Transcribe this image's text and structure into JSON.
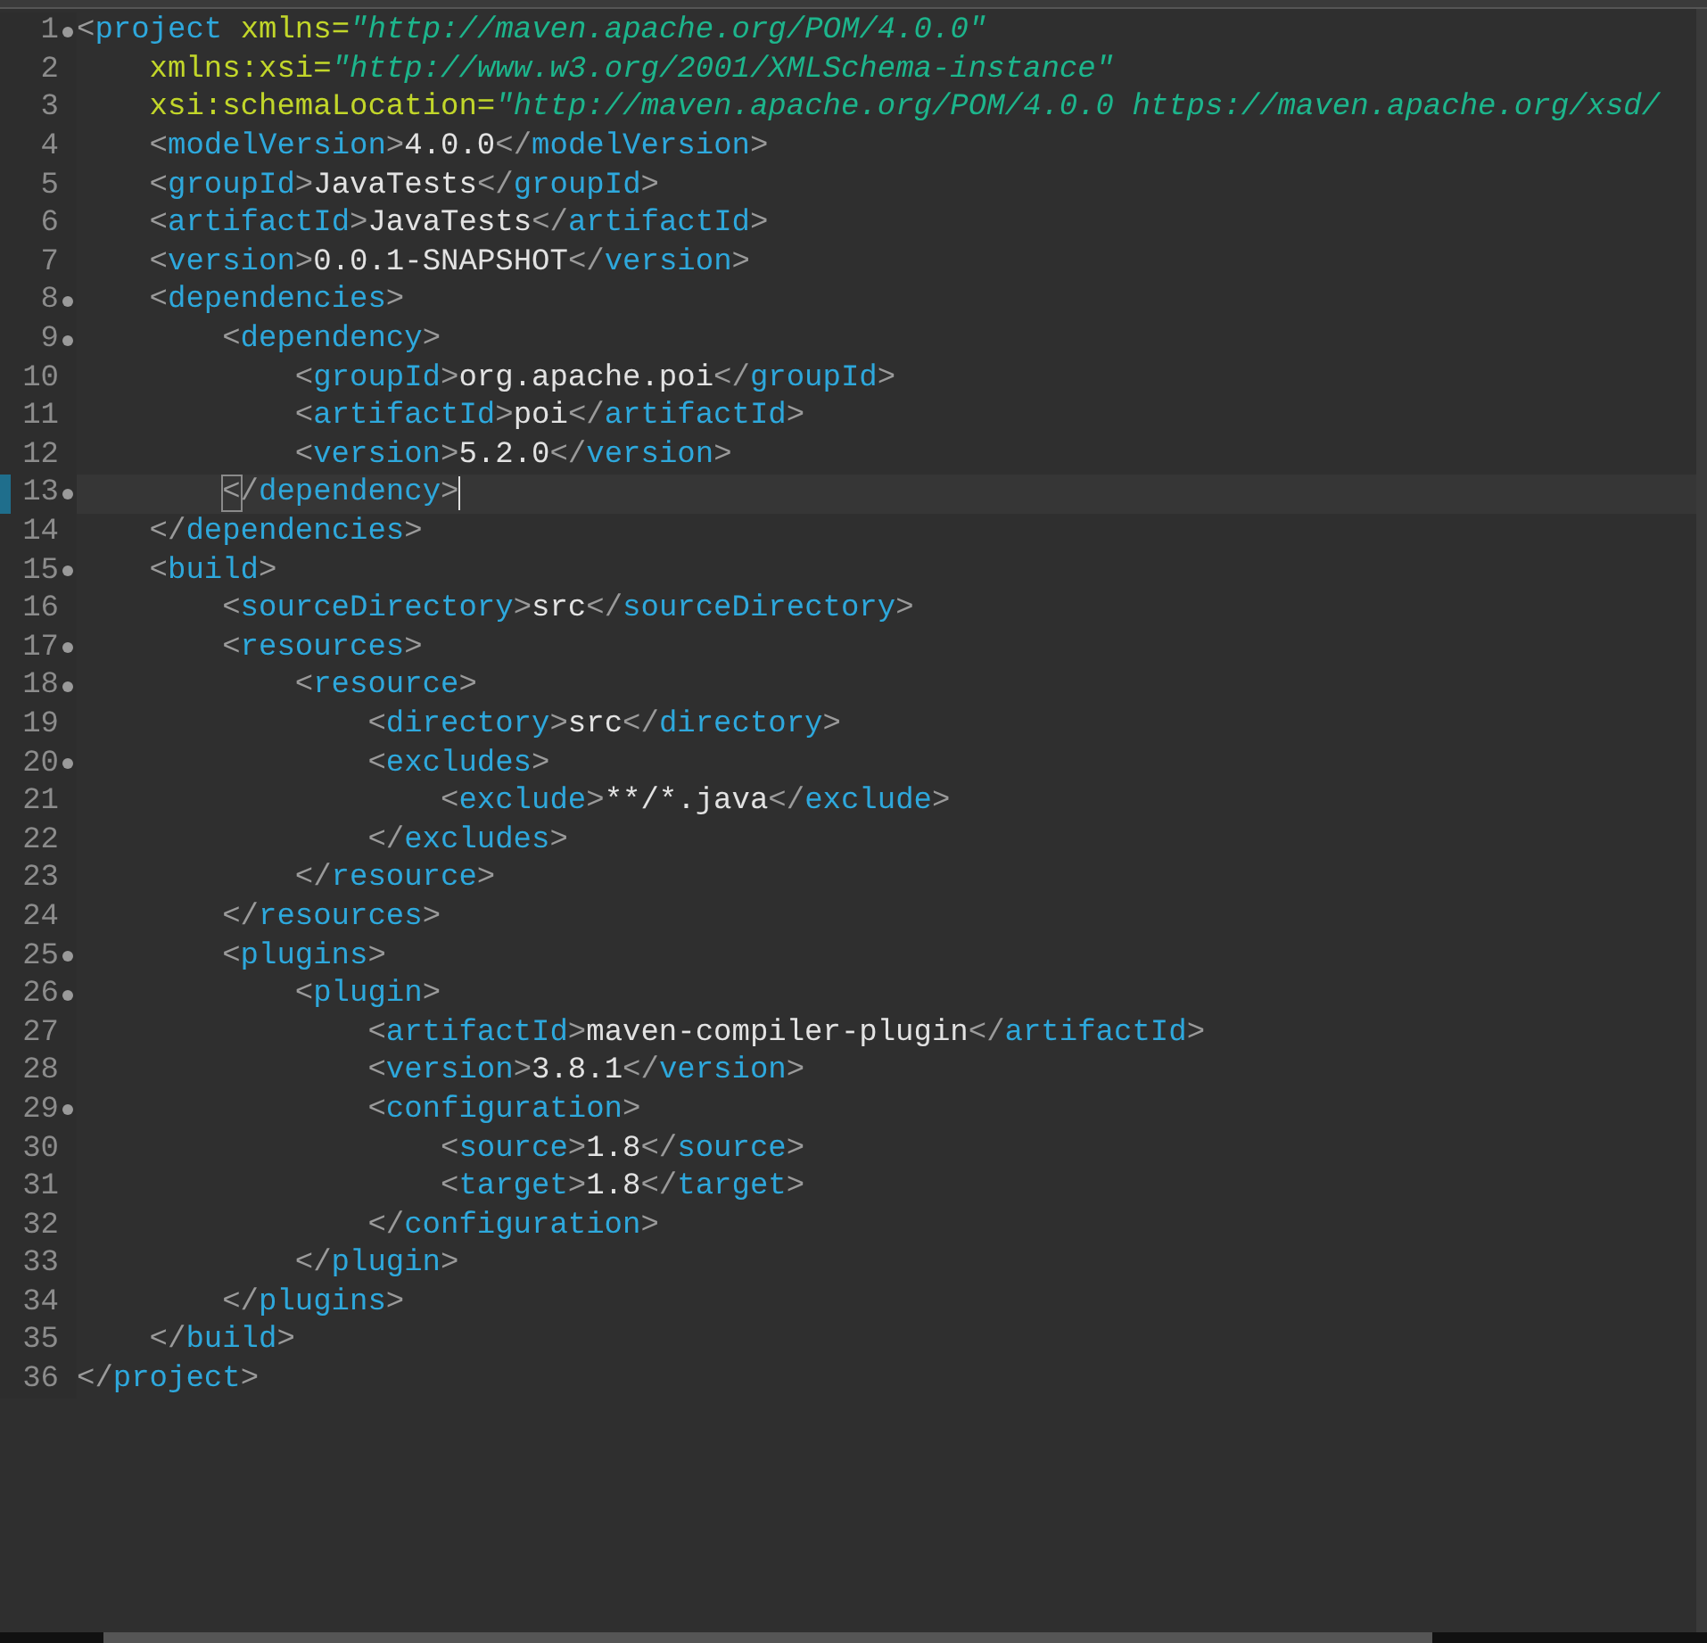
{
  "editor": {
    "lines": [
      {
        "number": "1",
        "foldable": true,
        "changed": false,
        "current": false,
        "tokens": [
          {
            "kind": "bracket",
            "text": "<"
          },
          {
            "kind": "tag",
            "text": "project "
          },
          {
            "kind": "attr",
            "text": "xmlns="
          },
          {
            "kind": "string",
            "text": "\"http://maven.apache.org/POM/4.0.0\""
          }
        ],
        "children": [
          {
            "number": "2",
            "foldable": false,
            "changed": false,
            "current": false,
            "tokens": [
              {
                "kind": "attr",
                "text": "xmlns:xsi="
              },
              {
                "kind": "string",
                "text": "\"http://www.w3.org/2001/XMLSchema-instance\""
              }
            ]
          },
          {
            "number": "3",
            "foldable": false,
            "changed": false,
            "current": false,
            "tokens": [
              {
                "kind": "attr",
                "text": "xsi:schemaLocation="
              },
              {
                "kind": "string",
                "text": "\"http://maven.apache.org/POM/4.0.0 https://maven.apache.org/xsd/"
              }
            ]
          },
          {
            "number": "4",
            "foldable": false,
            "changed": false,
            "current": false,
            "tokens": [
              {
                "kind": "bracket",
                "text": "<"
              },
              {
                "kind": "tag",
                "text": "modelVersion"
              },
              {
                "kind": "bracket",
                "text": ">"
              },
              {
                "kind": "text",
                "text": "4.0.0"
              },
              {
                "kind": "bracket",
                "text": "</"
              },
              {
                "kind": "tag",
                "text": "modelVersion"
              },
              {
                "kind": "bracket",
                "text": ">"
              }
            ]
          },
          {
            "number": "5",
            "foldable": false,
            "changed": false,
            "current": false,
            "tokens": [
              {
                "kind": "bracket",
                "text": "<"
              },
              {
                "kind": "tag",
                "text": "groupId"
              },
              {
                "kind": "bracket",
                "text": ">"
              },
              {
                "kind": "text",
                "text": "JavaTests"
              },
              {
                "kind": "bracket",
                "text": "</"
              },
              {
                "kind": "tag",
                "text": "groupId"
              },
              {
                "kind": "bracket",
                "text": ">"
              }
            ]
          },
          {
            "number": "6",
            "foldable": false,
            "changed": false,
            "current": false,
            "tokens": [
              {
                "kind": "bracket",
                "text": "<"
              },
              {
                "kind": "tag",
                "text": "artifactId"
              },
              {
                "kind": "bracket",
                "text": ">"
              },
              {
                "kind": "text",
                "text": "JavaTests"
              },
              {
                "kind": "bracket",
                "text": "</"
              },
              {
                "kind": "tag",
                "text": "artifactId"
              },
              {
                "kind": "bracket",
                "text": ">"
              }
            ]
          },
          {
            "number": "7",
            "foldable": false,
            "changed": false,
            "current": false,
            "tokens": [
              {
                "kind": "bracket",
                "text": "<"
              },
              {
                "kind": "tag",
                "text": "version"
              },
              {
                "kind": "bracket",
                "text": ">"
              },
              {
                "kind": "text",
                "text": "0.0.1-SNAPSHOT"
              },
              {
                "kind": "bracket",
                "text": "</"
              },
              {
                "kind": "tag",
                "text": "version"
              },
              {
                "kind": "bracket",
                "text": ">"
              }
            ]
          },
          {
            "number": "8",
            "foldable": true,
            "changed": false,
            "current": false,
            "tokens": [
              {
                "kind": "bracket",
                "text": "<"
              },
              {
                "kind": "tag",
                "text": "dependencies"
              },
              {
                "kind": "bracket",
                "text": ">"
              }
            ],
            "children": [
              {
                "number": "9",
                "foldable": true,
                "changed": false,
                "current": false,
                "tokens": [
                  {
                    "kind": "bracket",
                    "text": "<"
                  },
                  {
                    "kind": "tag",
                    "text": "dependency"
                  },
                  {
                    "kind": "bracket",
                    "text": ">"
                  }
                ],
                "children": [
                  {
                    "number": "10",
                    "foldable": false,
                    "changed": false,
                    "current": false,
                    "tokens": [
                      {
                        "kind": "bracket",
                        "text": "<"
                      },
                      {
                        "kind": "tag",
                        "text": "groupId"
                      },
                      {
                        "kind": "bracket",
                        "text": ">"
                      },
                      {
                        "kind": "text",
                        "text": "org.apache.poi"
                      },
                      {
                        "kind": "bracket",
                        "text": "</"
                      },
                      {
                        "kind": "tag",
                        "text": "groupId"
                      },
                      {
                        "kind": "bracket",
                        "text": ">"
                      }
                    ]
                  },
                  {
                    "number": "11",
                    "foldable": false,
                    "changed": false,
                    "current": false,
                    "tokens": [
                      {
                        "kind": "bracket",
                        "text": "<"
                      },
                      {
                        "kind": "tag",
                        "text": "artifactId"
                      },
                      {
                        "kind": "bracket",
                        "text": ">"
                      },
                      {
                        "kind": "text",
                        "text": "poi"
                      },
                      {
                        "kind": "bracket",
                        "text": "</"
                      },
                      {
                        "kind": "tag",
                        "text": "artifactId"
                      },
                      {
                        "kind": "bracket",
                        "text": ">"
                      }
                    ]
                  },
                  {
                    "number": "12",
                    "foldable": false,
                    "changed": false,
                    "current": false,
                    "tokens": [
                      {
                        "kind": "bracket",
                        "text": "<"
                      },
                      {
                        "kind": "tag",
                        "text": "version"
                      },
                      {
                        "kind": "bracket",
                        "text": ">"
                      },
                      {
                        "kind": "text",
                        "text": "5.2.0"
                      },
                      {
                        "kind": "bracket",
                        "text": "</"
                      },
                      {
                        "kind": "tag",
                        "text": "version"
                      },
                      {
                        "kind": "bracket",
                        "text": ">"
                      }
                    ]
                  }
                ]
              },
              {
                "number": "13",
                "foldable": true,
                "changed": true,
                "current": true,
                "tokens": [
                  {
                    "kind": "matched-bracket",
                    "text": "<"
                  },
                  {
                    "kind": "bracket",
                    "text": "/"
                  },
                  {
                    "kind": "tag",
                    "text": "dependency"
                  },
                  {
                    "kind": "bracket",
                    "text": ">"
                  }
                ]
              }
            ]
          },
          {
            "number": "14",
            "foldable": false,
            "changed": false,
            "current": false,
            "tokens": [
              {
                "kind": "bracket",
                "text": "</"
              },
              {
                "kind": "tag",
                "text": "dependencies"
              },
              {
                "kind": "bracket",
                "text": ">"
              }
            ]
          },
          {
            "number": "15",
            "foldable": true,
            "changed": false,
            "current": false,
            "tokens": [
              {
                "kind": "bracket",
                "text": "<"
              },
              {
                "kind": "tag",
                "text": "build"
              },
              {
                "kind": "bracket",
                "text": ">"
              }
            ],
            "children": [
              {
                "number": "16",
                "foldable": false,
                "changed": false,
                "current": false,
                "tokens": [
                  {
                    "kind": "bracket",
                    "text": "<"
                  },
                  {
                    "kind": "tag",
                    "text": "sourceDirectory"
                  },
                  {
                    "kind": "bracket",
                    "text": ">"
                  },
                  {
                    "kind": "text",
                    "text": "src"
                  },
                  {
                    "kind": "bracket",
                    "text": "</"
                  },
                  {
                    "kind": "tag",
                    "text": "sourceDirectory"
                  },
                  {
                    "kind": "bracket",
                    "text": ">"
                  }
                ]
              },
              {
                "number": "17",
                "foldable": true,
                "changed": false,
                "current": false,
                "tokens": [
                  {
                    "kind": "bracket",
                    "text": "<"
                  },
                  {
                    "kind": "tag",
                    "text": "resources"
                  },
                  {
                    "kind": "bracket",
                    "text": ">"
                  }
                ],
                "children": [
                  {
                    "number": "18",
                    "foldable": true,
                    "changed": false,
                    "current": false,
                    "tokens": [
                      {
                        "kind": "bracket",
                        "text": "<"
                      },
                      {
                        "kind": "tag",
                        "text": "resource"
                      },
                      {
                        "kind": "bracket",
                        "text": ">"
                      }
                    ],
                    "children": [
                      {
                        "number": "19",
                        "foldable": false,
                        "changed": false,
                        "current": false,
                        "tokens": [
                          {
                            "kind": "bracket",
                            "text": "<"
                          },
                          {
                            "kind": "tag",
                            "text": "directory"
                          },
                          {
                            "kind": "bracket",
                            "text": ">"
                          },
                          {
                            "kind": "text",
                            "text": "src"
                          },
                          {
                            "kind": "bracket",
                            "text": "</"
                          },
                          {
                            "kind": "tag",
                            "text": "directory"
                          },
                          {
                            "kind": "bracket",
                            "text": ">"
                          }
                        ]
                      },
                      {
                        "number": "20",
                        "foldable": true,
                        "changed": false,
                        "current": false,
                        "tokens": [
                          {
                            "kind": "bracket",
                            "text": "<"
                          },
                          {
                            "kind": "tag",
                            "text": "excludes"
                          },
                          {
                            "kind": "bracket",
                            "text": ">"
                          }
                        ],
                        "children": [
                          {
                            "number": "21",
                            "foldable": false,
                            "changed": false,
                            "current": false,
                            "tokens": [
                              {
                                "kind": "bracket",
                                "text": "<"
                              },
                              {
                                "kind": "tag",
                                "text": "exclude"
                              },
                              {
                                "kind": "bracket",
                                "text": ">"
                              },
                              {
                                "kind": "text",
                                "text": "**/*.java"
                              },
                              {
                                "kind": "bracket",
                                "text": "</"
                              },
                              {
                                "kind": "tag",
                                "text": "exclude"
                              },
                              {
                                "kind": "bracket",
                                "text": ">"
                              }
                            ]
                          }
                        ]
                      },
                      {
                        "number": "22",
                        "foldable": false,
                        "changed": false,
                        "current": false,
                        "tokens": [
                          {
                            "kind": "bracket",
                            "text": "</"
                          },
                          {
                            "kind": "tag",
                            "text": "excludes"
                          },
                          {
                            "kind": "bracket",
                            "text": ">"
                          }
                        ]
                      }
                    ]
                  },
                  {
                    "number": "23",
                    "foldable": false,
                    "changed": false,
                    "current": false,
                    "tokens": [
                      {
                        "kind": "bracket",
                        "text": "</"
                      },
                      {
                        "kind": "tag",
                        "text": "resource"
                      },
                      {
                        "kind": "bracket",
                        "text": ">"
                      }
                    ]
                  }
                ]
              },
              {
                "number": "24",
                "foldable": false,
                "changed": false,
                "current": false,
                "tokens": [
                  {
                    "kind": "bracket",
                    "text": "</"
                  },
                  {
                    "kind": "tag",
                    "text": "resources"
                  },
                  {
                    "kind": "bracket",
                    "text": ">"
                  }
                ]
              },
              {
                "number": "25",
                "foldable": true,
                "changed": false,
                "current": false,
                "tokens": [
                  {
                    "kind": "bracket",
                    "text": "<"
                  },
                  {
                    "kind": "tag",
                    "text": "plugins"
                  },
                  {
                    "kind": "bracket",
                    "text": ">"
                  }
                ],
                "children": [
                  {
                    "number": "26",
                    "foldable": true,
                    "changed": false,
                    "current": false,
                    "tokens": [
                      {
                        "kind": "bracket",
                        "text": "<"
                      },
                      {
                        "kind": "tag",
                        "text": "plugin"
                      },
                      {
                        "kind": "bracket",
                        "text": ">"
                      }
                    ],
                    "children": [
                      {
                        "number": "27",
                        "foldable": false,
                        "changed": false,
                        "current": false,
                        "tokens": [
                          {
                            "kind": "bracket",
                            "text": "<"
                          },
                          {
                            "kind": "tag",
                            "text": "artifactId"
                          },
                          {
                            "kind": "bracket",
                            "text": ">"
                          },
                          {
                            "kind": "text",
                            "text": "maven-compiler-plugin"
                          },
                          {
                            "kind": "bracket",
                            "text": "</"
                          },
                          {
                            "kind": "tag",
                            "text": "artifactId"
                          },
                          {
                            "kind": "bracket",
                            "text": ">"
                          }
                        ]
                      },
                      {
                        "number": "28",
                        "foldable": false,
                        "changed": false,
                        "current": false,
                        "tokens": [
                          {
                            "kind": "bracket",
                            "text": "<"
                          },
                          {
                            "kind": "tag",
                            "text": "version"
                          },
                          {
                            "kind": "bracket",
                            "text": ">"
                          },
                          {
                            "kind": "text",
                            "text": "3.8.1"
                          },
                          {
                            "kind": "bracket",
                            "text": "</"
                          },
                          {
                            "kind": "tag",
                            "text": "version"
                          },
                          {
                            "kind": "bracket",
                            "text": ">"
                          }
                        ]
                      },
                      {
                        "number": "29",
                        "foldable": true,
                        "changed": false,
                        "current": false,
                        "tokens": [
                          {
                            "kind": "bracket",
                            "text": "<"
                          },
                          {
                            "kind": "tag",
                            "text": "configuration"
                          },
                          {
                            "kind": "bracket",
                            "text": ">"
                          }
                        ],
                        "children": [
                          {
                            "number": "30",
                            "foldable": false,
                            "changed": false,
                            "current": false,
                            "tokens": [
                              {
                                "kind": "bracket",
                                "text": "<"
                              },
                              {
                                "kind": "tag",
                                "text": "source"
                              },
                              {
                                "kind": "bracket",
                                "text": ">"
                              },
                              {
                                "kind": "text",
                                "text": "1.8"
                              },
                              {
                                "kind": "bracket",
                                "text": "</"
                              },
                              {
                                "kind": "tag",
                                "text": "source"
                              },
                              {
                                "kind": "bracket",
                                "text": ">"
                              }
                            ]
                          },
                          {
                            "number": "31",
                            "foldable": false,
                            "changed": false,
                            "current": false,
                            "tokens": [
                              {
                                "kind": "bracket",
                                "text": "<"
                              },
                              {
                                "kind": "tag",
                                "text": "target"
                              },
                              {
                                "kind": "bracket",
                                "text": ">"
                              },
                              {
                                "kind": "text",
                                "text": "1.8"
                              },
                              {
                                "kind": "bracket",
                                "text": "</"
                              },
                              {
                                "kind": "tag",
                                "text": "target"
                              },
                              {
                                "kind": "bracket",
                                "text": ">"
                              }
                            ]
                          }
                        ]
                      },
                      {
                        "number": "32",
                        "foldable": false,
                        "changed": false,
                        "current": false,
                        "tokens": [
                          {
                            "kind": "bracket",
                            "text": "</"
                          },
                          {
                            "kind": "tag",
                            "text": "configuration"
                          },
                          {
                            "kind": "bracket",
                            "text": ">"
                          }
                        ]
                      }
                    ]
                  },
                  {
                    "number": "33",
                    "foldable": false,
                    "changed": false,
                    "current": false,
                    "tokens": [
                      {
                        "kind": "bracket",
                        "text": "</"
                      },
                      {
                        "kind": "tag",
                        "text": "plugin"
                      },
                      {
                        "kind": "bracket",
                        "text": ">"
                      }
                    ]
                  }
                ]
              },
              {
                "number": "34",
                "foldable": false,
                "changed": false,
                "current": false,
                "tokens": [
                  {
                    "kind": "bracket",
                    "text": "</"
                  },
                  {
                    "kind": "tag",
                    "text": "plugins"
                  },
                  {
                    "kind": "bracket",
                    "text": ">"
                  }
                ]
              }
            ]
          },
          {
            "number": "35",
            "foldable": false,
            "changed": false,
            "current": false,
            "tokens": [
              {
                "kind": "bracket",
                "text": "</"
              },
              {
                "kind": "tag",
                "text": "build"
              },
              {
                "kind": "bracket",
                "text": ">"
              }
            ]
          }
        ]
      },
      {
        "number": "36",
        "foldable": false,
        "changed": false,
        "current": false,
        "tokens": [
          {
            "kind": "bracket",
            "text": "</"
          },
          {
            "kind": "tag",
            "text": "project"
          },
          {
            "kind": "bracket",
            "text": ">"
          }
        ]
      }
    ]
  }
}
